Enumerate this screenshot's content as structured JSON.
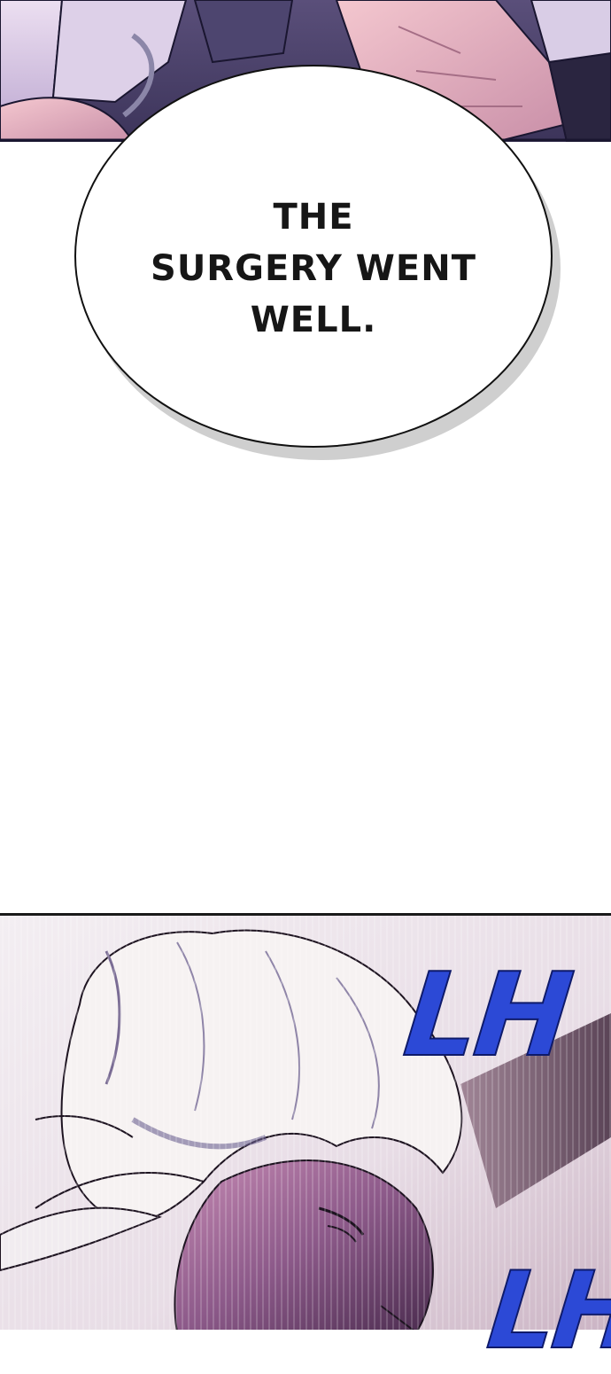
{
  "speech_bubble": {
    "lines": [
      "THE",
      "SURGERY WENT",
      "WELL."
    ]
  },
  "sound_effects": {
    "first": "LH",
    "second": "LH"
  },
  "colors": {
    "speech_text": "#161616",
    "sfx_fill": "#2c49d6",
    "sfx_outline": "#0e1a6a",
    "panel_border": "#1a1a1a",
    "hair": "#f6f2f2",
    "skin_shadow": "#8d5a8a"
  }
}
